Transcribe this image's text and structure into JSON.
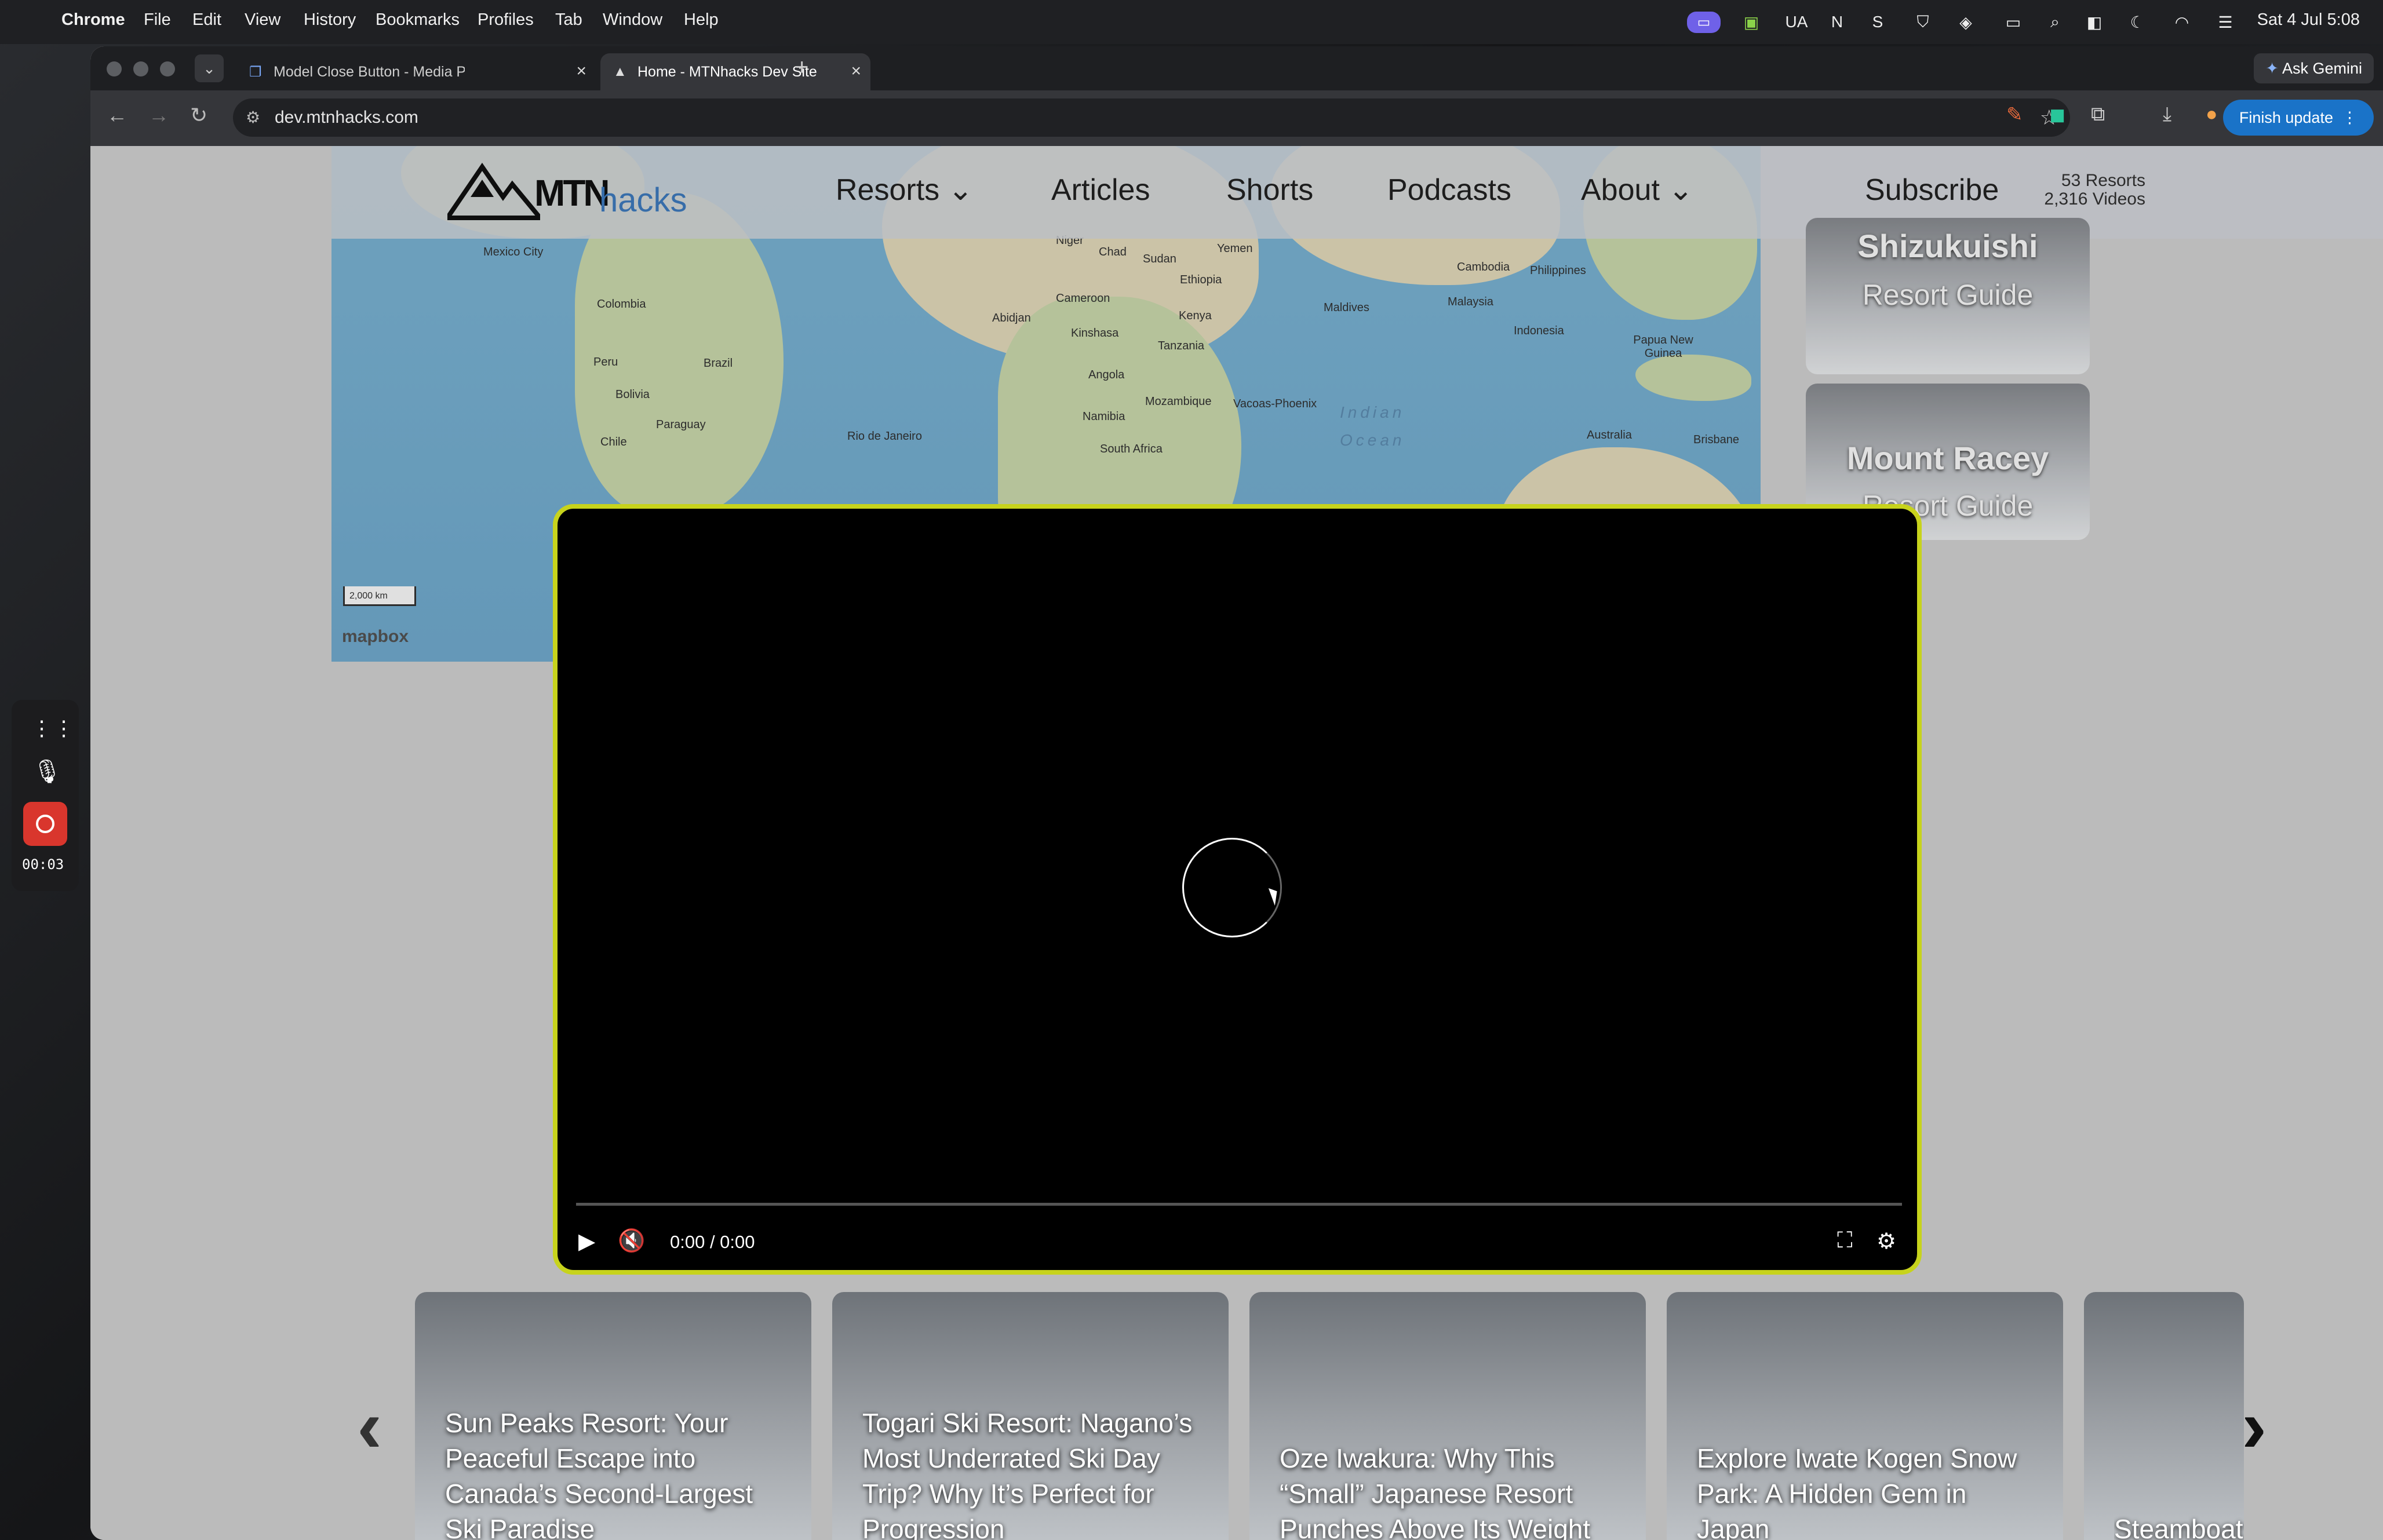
{
  "menubar": {
    "app": "Chrome",
    "items": [
      "File",
      "Edit",
      "View",
      "History",
      "Bookmarks",
      "Profiles",
      "Tab",
      "Window",
      "Help"
    ],
    "tray": [
      "UA",
      "N",
      "S"
    ],
    "clock": "Sat 4 Jul  5:08"
  },
  "tabs": [
    {
      "title": "Model Close Button - Media P",
      "close": "×"
    },
    {
      "title": "Home - MTNhacks Dev Site",
      "close": "×"
    }
  ],
  "tab_bar": {
    "new_tab": "+",
    "ask_gemini": "Ask Gemini"
  },
  "toolbar": {
    "url": "dev.mtnhacks.com",
    "finish_update": "Finish update"
  },
  "site": {
    "logo_mtn": "MTN",
    "logo_hacks": "hacks",
    "nav": [
      "Resorts",
      "Articles",
      "Shorts",
      "Podcasts",
      "About",
      "Subscribe"
    ],
    "stats_resorts": "53 Resorts",
    "stats_videos": "2,316 Videos"
  },
  "map": {
    "labels": [
      "Mexico City",
      "Colombia",
      "Peru",
      "Brazil",
      "Bolivia",
      "Paraguay",
      "Chile",
      "Rio de Janeiro",
      "Niger",
      "Chad",
      "Sudan",
      "Yemen",
      "Ethiopia",
      "Cameroon",
      "Abidjan",
      "Kinshasa",
      "Kenya",
      "Tanzania",
      "Angola",
      "Namibia",
      "Mozambique",
      "Vacoas-Phoenix",
      "South Africa",
      "Maldives",
      "Cambodia",
      "Philippines",
      "Malaysia",
      "Indonesia",
      "Papua New Guinea",
      "Australia",
      "Brisbane"
    ],
    "ocean_1": "Indian",
    "ocean_2": "Ocean",
    "scale": "2,000 km",
    "attribution": "mapbox"
  },
  "side_cards": [
    {
      "name": "Shizukuishi",
      "sub": "Resort Guide"
    },
    {
      "name": "Mount Racey",
      "sub": "Resort Guide"
    }
  ],
  "video": {
    "timecode": "0:00 / 0:00",
    "progress": 0
  },
  "articles": [
    "Sun Peaks Resort: Your Peaceful Escape into Canada’s Second-Largest Ski Paradise",
    "Togari Ski Resort: Nagano’s Most Underrated Ski Day Trip? Why It’s Perfect for Progression",
    "Oze Iwakura: Why This “Small” Japanese Resort Punches Above Its Weight",
    "Explore Iwate Kogen Snow Park: A Hidden Gem in Japan",
    "Steamboat: Why It’s a Perfect Intermediate Destination"
  ],
  "recorder": {
    "timer": "00:03"
  },
  "colors": {
    "modal_border": "#c7d31c",
    "brand_blue": "#3f7dc1",
    "record_red": "#d9362d",
    "update_blue": "#1a73c8"
  },
  "icons": [
    "apple-icon",
    "play-icon",
    "mute-icon",
    "fullscreen-icon",
    "settings-icon",
    "chevron-left-icon",
    "chevron-right-icon",
    "microphone-off-icon",
    "record-icon"
  ]
}
